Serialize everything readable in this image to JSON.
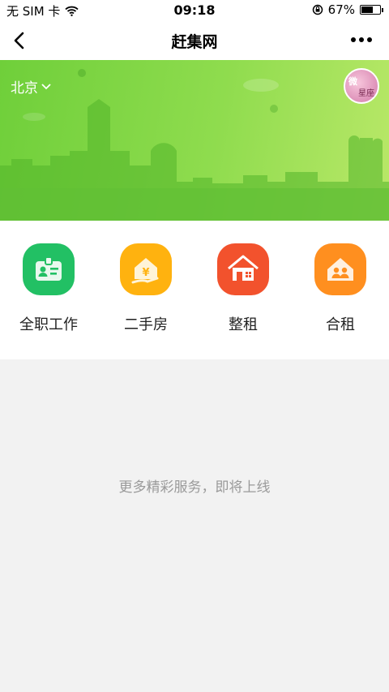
{
  "status_bar": {
    "carrier": "无 SIM 卡",
    "time": "09:18",
    "battery_percent": "67%",
    "battery_level": 0.67
  },
  "nav": {
    "title": "赶集网"
  },
  "banner": {
    "city": "北京",
    "avatar_text_1": "微",
    "avatar_text_2": "星座"
  },
  "services": [
    {
      "label": "全职工作",
      "color": "#22c064",
      "icon": "id-card-icon"
    },
    {
      "label": "二手房",
      "color": "#ffb20f",
      "icon": "house-yen-icon"
    },
    {
      "label": "整租",
      "color": "#f2522d",
      "icon": "house-icon"
    },
    {
      "label": "合租",
      "color": "#ff8f1f",
      "icon": "shared-house-icon"
    }
  ],
  "empty_state": {
    "message": "更多精彩服务，即将上线"
  }
}
